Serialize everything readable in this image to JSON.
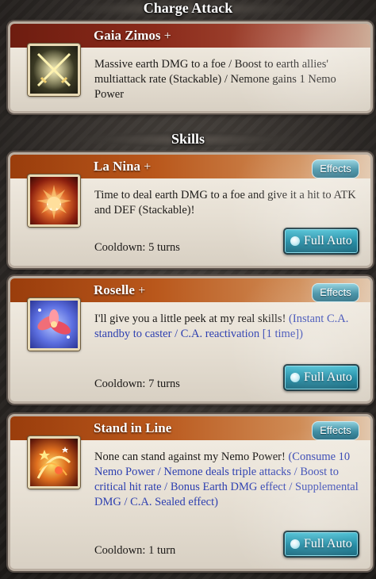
{
  "sections": {
    "charge_attack": "Charge Attack",
    "skills": "Skills"
  },
  "charge_attack": {
    "name": "Gaia Zimos",
    "plus": "+",
    "description": "Massive earth DMG to a foe / Boost to earth allies' multiattack rate (Stackable) / Nemone gains 1 Nemo Power",
    "icon": "crossed-swords-icon"
  },
  "skills": [
    {
      "name": "La Nina",
      "plus": "+",
      "description": "Time to deal earth DMG to a foe and give it a hit to ATK and DEF (Stackable)!",
      "extra": "",
      "cooldown": "Cooldown: 5 turns",
      "effects_label": "Effects",
      "full_auto_label": "Full Auto",
      "icon": "explosion-icon"
    },
    {
      "name": "Roselle",
      "plus": "+",
      "description": "I'll give you a little peek at my real skills!",
      "extra": "(Instant C.A. standby to caster / C.A. reactivation [1 time])",
      "cooldown": "Cooldown: 7 turns",
      "effects_label": "Effects",
      "full_auto_label": "Full Auto",
      "icon": "rose-icon"
    },
    {
      "name": "Stand in Line",
      "plus": "",
      "description": "None can stand against my Nemo Power!",
      "extra": "(Consume 10 Nemo Power / Nemone deals triple attacks / Boost to critical hit rate / Bonus Earth DMG effect / Supplemental DMG / C.A. Sealed effect)",
      "cooldown": "Cooldown: 1 turn",
      "effects_label": "Effects",
      "full_auto_label": "Full Auto",
      "icon": "sparkle-burst-icon"
    }
  ]
}
